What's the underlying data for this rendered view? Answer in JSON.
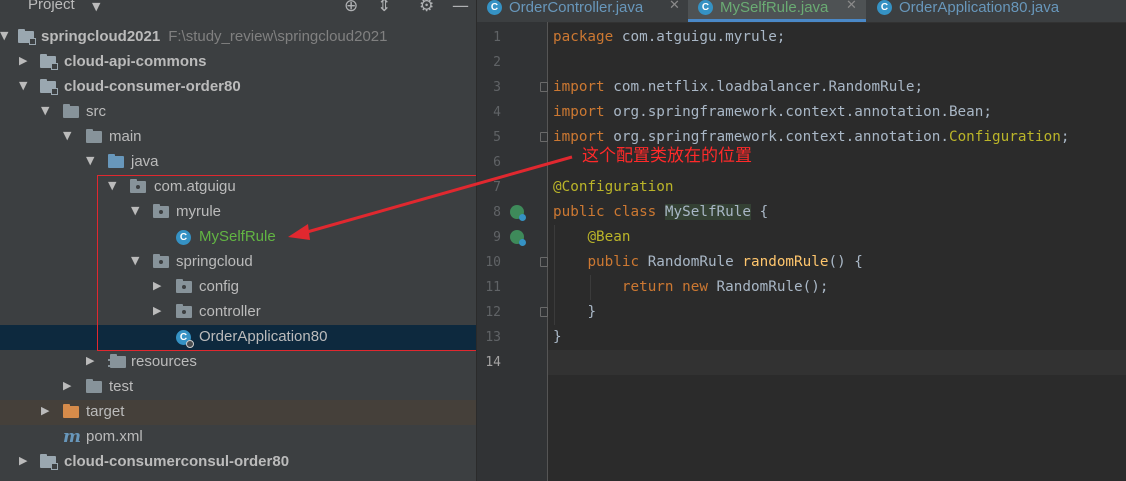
{
  "project_panel": {
    "title": "Project",
    "tree": [
      {
        "label": "springcloud2021",
        "path": "F:\\study_review\\springcloud2021",
        "type": "module"
      },
      {
        "label": "cloud-api-commons",
        "type": "module"
      },
      {
        "label": "cloud-consumer-order80",
        "type": "module"
      },
      {
        "label": "src",
        "type": "folder"
      },
      {
        "label": "main",
        "type": "folder"
      },
      {
        "label": "java",
        "type": "source-root"
      },
      {
        "label": "com.atguigu",
        "type": "package"
      },
      {
        "label": "myrule",
        "type": "package"
      },
      {
        "label": "MySelfRule",
        "type": "class"
      },
      {
        "label": "springcloud",
        "type": "package"
      },
      {
        "label": "config",
        "type": "package"
      },
      {
        "label": "controller",
        "type": "package"
      },
      {
        "label": "OrderApplication80",
        "type": "class",
        "selected": true
      },
      {
        "label": "resources",
        "type": "resources"
      },
      {
        "label": "test",
        "type": "folder"
      },
      {
        "label": "target",
        "type": "excluded"
      },
      {
        "label": "pom.xml",
        "type": "maven"
      },
      {
        "label": "cloud-consumerconsul-order80",
        "type": "module"
      }
    ]
  },
  "tabs": [
    {
      "label": "OrderController.java",
      "active": false
    },
    {
      "label": "MySelfRule.java",
      "active": true
    },
    {
      "label": "OrderApplication80.java",
      "active": false
    }
  ],
  "editor": {
    "line_numbers": [
      "1",
      "2",
      "3",
      "4",
      "5",
      "6",
      "7",
      "8",
      "9",
      "10",
      "11",
      "12",
      "13",
      "14"
    ],
    "lines": {
      "l1": {
        "kw": "package",
        "rest": " com.atguigu.myrule;"
      },
      "l3": {
        "kw": "import",
        "rest": " com.netflix.loadbalancer.RandomRule;"
      },
      "l4": {
        "kw": "import",
        "rest": " org.springframework.context.annotation.Bean;"
      },
      "l5": {
        "kw": "import",
        "rest": " org.springframework.context.annotation.",
        "ann": "Configuration",
        "end": ";"
      },
      "l7": {
        "ann": "@Configuration"
      },
      "l8": {
        "kw": "public class",
        "cls": "MySelfRule",
        "rest": " {"
      },
      "l9": {
        "ann": "@Bean"
      },
      "l10": {
        "kw": "public",
        "type": " RandomRule ",
        "fn": "randomRule",
        "rest": "() {"
      },
      "l11": {
        "kw": "return new",
        "rest": " RandomRule();"
      },
      "l12": {
        "rest": "}"
      },
      "l13": {
        "rest": "}"
      }
    }
  },
  "annotation": {
    "text": "这个配置类放在的位置",
    "color": "#e0282f"
  },
  "colors": {
    "keyword": "#cc7832",
    "annotation": "#bbb529",
    "function": "#ffc66d",
    "class_name_green": "#62b543",
    "selection": "#0d293e"
  },
  "icons": [
    "settings-crosshair-icon",
    "collapse-icon",
    "gear-icon",
    "minimize-icon",
    "class-icon",
    "maven-icon",
    "folder-icon",
    "package-icon"
  ]
}
